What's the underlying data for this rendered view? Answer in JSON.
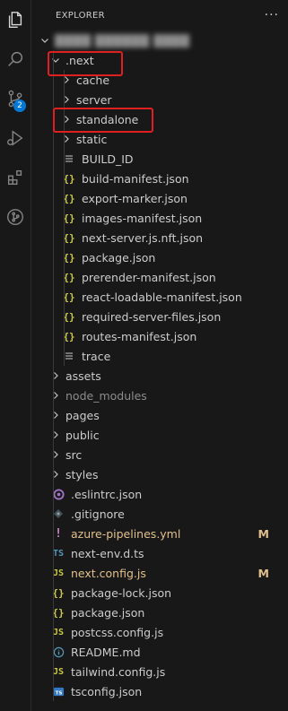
{
  "explorer": {
    "title": "EXPLORER",
    "more_actions": "···"
  },
  "activity_bar": {
    "scm_badge": "2"
  },
  "root": {
    "label": "████ ██████ ████"
  },
  "tree": [
    {
      "name": ".next",
      "depth": 1,
      "type": "folder",
      "open": true,
      "icon": "chevron-down-icon"
    },
    {
      "name": "cache",
      "depth": 2,
      "type": "folder",
      "icon": "chevron-right-icon"
    },
    {
      "name": "server",
      "depth": 2,
      "type": "folder",
      "icon": "chevron-right-icon"
    },
    {
      "name": "standalone",
      "depth": 2,
      "type": "folder",
      "icon": "chevron-right-icon"
    },
    {
      "name": "static",
      "depth": 2,
      "type": "folder",
      "icon": "chevron-right-icon"
    },
    {
      "name": "BUILD_ID",
      "depth": 2,
      "type": "file",
      "icon": "lines-icon"
    },
    {
      "name": "build-manifest.json",
      "depth": 2,
      "type": "file",
      "icon": "json-icon"
    },
    {
      "name": "export-marker.json",
      "depth": 2,
      "type": "file",
      "icon": "json-icon"
    },
    {
      "name": "images-manifest.json",
      "depth": 2,
      "type": "file",
      "icon": "json-icon"
    },
    {
      "name": "next-server.js.nft.json",
      "depth": 2,
      "type": "file",
      "icon": "json-icon"
    },
    {
      "name": "package.json",
      "depth": 2,
      "type": "file",
      "icon": "json-icon"
    },
    {
      "name": "prerender-manifest.json",
      "depth": 2,
      "type": "file",
      "icon": "json-icon"
    },
    {
      "name": "react-loadable-manifest.json",
      "depth": 2,
      "type": "file",
      "icon": "json-icon"
    },
    {
      "name": "required-server-files.json",
      "depth": 2,
      "type": "file",
      "icon": "json-icon"
    },
    {
      "name": "routes-manifest.json",
      "depth": 2,
      "type": "file",
      "icon": "json-icon"
    },
    {
      "name": "trace",
      "depth": 2,
      "type": "file",
      "icon": "lines-icon"
    },
    {
      "name": "assets",
      "depth": 1,
      "type": "folder",
      "icon": "chevron-right-icon"
    },
    {
      "name": "node_modules",
      "depth": 1,
      "type": "folder",
      "icon": "chevron-right-icon",
      "dim": true
    },
    {
      "name": "pages",
      "depth": 1,
      "type": "folder",
      "icon": "chevron-right-icon"
    },
    {
      "name": "public",
      "depth": 1,
      "type": "folder",
      "icon": "chevron-right-icon"
    },
    {
      "name": "src",
      "depth": 1,
      "type": "folder",
      "icon": "chevron-right-icon"
    },
    {
      "name": "styles",
      "depth": 1,
      "type": "folder",
      "icon": "chevron-right-icon"
    },
    {
      "name": ".eslintrc.json",
      "depth": 1,
      "type": "file",
      "icon": "eslint-icon"
    },
    {
      "name": ".gitignore",
      "depth": 1,
      "type": "file",
      "icon": "git-icon"
    },
    {
      "name": "azure-pipelines.yml",
      "depth": 1,
      "type": "file",
      "icon": "yaml-icon",
      "status": "M",
      "modified": true
    },
    {
      "name": "next-env.d.ts",
      "depth": 1,
      "type": "file",
      "icon": "ts-icon"
    },
    {
      "name": "next.config.js",
      "depth": 1,
      "type": "file",
      "icon": "js-icon",
      "status": "M",
      "modified": true
    },
    {
      "name": "package-lock.json",
      "depth": 1,
      "type": "file",
      "icon": "json-icon"
    },
    {
      "name": "package.json",
      "depth": 1,
      "type": "file",
      "icon": "json-icon"
    },
    {
      "name": "postcss.config.js",
      "depth": 1,
      "type": "file",
      "icon": "js-icon"
    },
    {
      "name": "README.md",
      "depth": 1,
      "type": "file",
      "icon": "info-icon"
    },
    {
      "name": "tailwind.config.js",
      "depth": 1,
      "type": "file",
      "icon": "js-icon"
    },
    {
      "name": "tsconfig.json",
      "depth": 1,
      "type": "file",
      "icon": "tsconfig-icon"
    }
  ],
  "colors": {
    "background": "#181818",
    "modified": "#e2c08d",
    "highlight": "#e02020",
    "badge": "#0078d4"
  }
}
